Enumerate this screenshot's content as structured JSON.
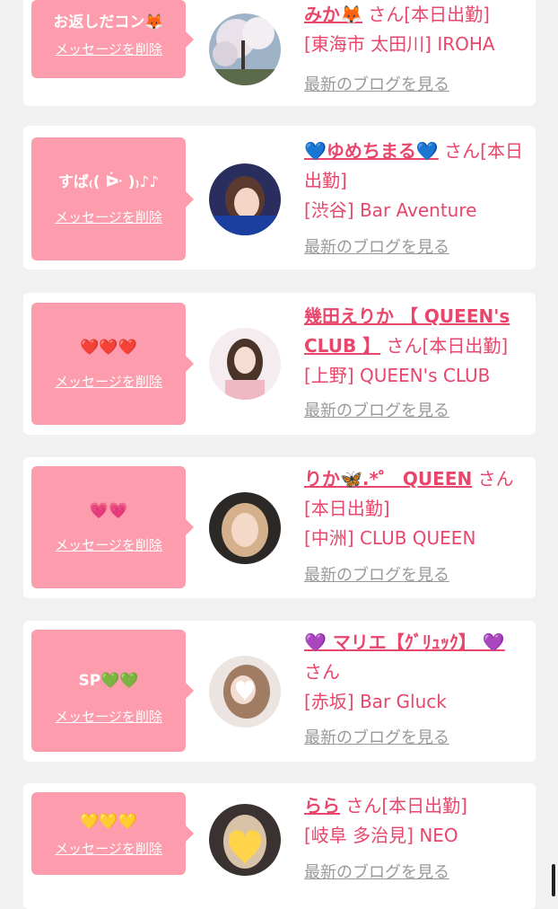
{
  "colors": {
    "accent": "#e8466b",
    "bubble": "#fd9cac",
    "card": "#ffffff",
    "background": "#f1f1f1",
    "link_gray": "#999999"
  },
  "cards": [
    {
      "message": "お返しだコン🦊",
      "delete_label": "メッセージを削除",
      "name": "みか🦊",
      "san": " さん[本日出勤]",
      "shop": "[東海市 太田川] IROHA",
      "blog_label": "最新のブログを見る",
      "avatar_icon": "cherry-blossom-photo"
    },
    {
      "message": "すば₍( ᐕ )₎♪♪",
      "delete_label": "メッセージを削除",
      "name": "💙ゆめちまる💙",
      "san": " さん[本日出勤]",
      "shop": "[渋谷] Bar Aventure",
      "blog_label": "最新のブログを見る",
      "avatar_icon": "girl-photo"
    },
    {
      "message": "❤️❤️❤️",
      "delete_label": "メッセージを削除",
      "name": "幾田えりか 【 QUEEN's CLUB 】",
      "san": " さん[本日出勤]",
      "shop": "[上野] QUEEN's CLUB",
      "blog_label": "最新のブログを見る",
      "avatar_icon": "girl-photo"
    },
    {
      "message": "💗💗",
      "delete_label": "メッセージを削除",
      "name": "りか🦋.*゜ QUEEN",
      "san": " さん[本日出勤]",
      "shop": "[中洲] CLUB QUEEN",
      "blog_label": "最新のブログを見る",
      "avatar_icon": "girl-photo"
    },
    {
      "message": "SP💚💚",
      "delete_label": "メッセージを削除",
      "name": "💜 マリエ【ｸﾞﾘｭｯｸ】 💜",
      "san": " さん",
      "shop": "[赤坂] Bar Gluck",
      "blog_label": "最新のブログを見る",
      "avatar_icon": "girl-heart-photo"
    },
    {
      "message": "💛💛💛",
      "delete_label": "メッセージを削除",
      "name": "らら",
      "san": " さん[本日出勤]",
      "shop": "[岐阜 多治見] NEO",
      "blog_label": "最新のブログを見る",
      "avatar_icon": "girl-heart-photo"
    }
  ]
}
